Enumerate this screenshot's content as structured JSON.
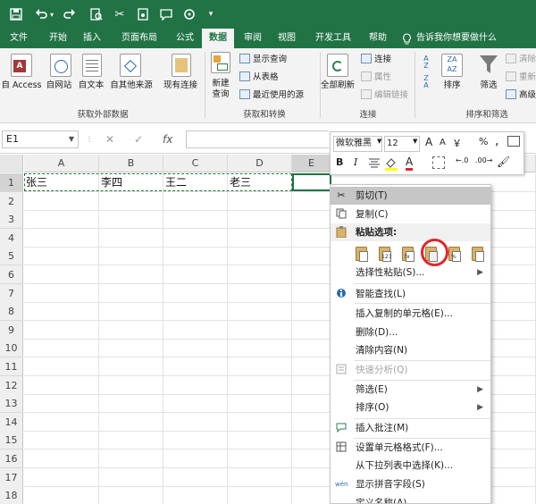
{
  "qat": {
    "icons": [
      "save-icon",
      "undo-icon",
      "undo-dropdown-icon",
      "redo-icon",
      "print-preview-icon",
      "cut-icon",
      "camera-icon",
      "comment-icon",
      "settings-icon",
      "customize-icon"
    ]
  },
  "tabs": [
    "文件",
    "开始",
    "插入",
    "页面布局",
    "公式",
    "数据",
    "审阅",
    "视图",
    "开发工具",
    "帮助",
    "告诉我你想要做什么"
  ],
  "active_tab": "数据",
  "ribbon": {
    "get_external": {
      "label": "获取外部数据",
      "buttons": [
        "自 Access",
        "自网站",
        "自文本",
        "自其他来源",
        "现有连接"
      ]
    },
    "get_transform": {
      "label": "获取和转换",
      "new_query": "新建\n查询",
      "new_query_1": "新建",
      "new_query_2": "查询",
      "small": [
        "显示查询",
        "从表格",
        "最近使用的源"
      ]
    },
    "connections": {
      "label": "连接",
      "refresh_all": "全部刷新",
      "small": [
        "连接",
        "属性",
        "编辑链接"
      ]
    },
    "sort_filter": {
      "label": "排序和筛选",
      "sort": "排序",
      "filter": "筛选",
      "small": [
        "清除",
        "重新",
        "高级"
      ]
    }
  },
  "formula_bar": {
    "name_box": "E1",
    "cancel": "✕",
    "enter": "✓",
    "fx": "fx",
    "value": ""
  },
  "columns": [
    "A",
    "B",
    "C",
    "D",
    "E"
  ],
  "rows": [
    "1",
    "2",
    "3",
    "4",
    "5",
    "6",
    "7",
    "8",
    "9",
    "10",
    "11",
    "12",
    "13",
    "14",
    "15",
    "16",
    "17",
    "18"
  ],
  "cells": {
    "A1": "张三",
    "B1": "李四",
    "C1": "王二",
    "D1": "老三"
  },
  "mini_toolbar": {
    "font_name": "微软雅黑",
    "font_size": "12",
    "grow": "A",
    "shrink": "A",
    "currency": "￥",
    "percent": "%",
    "comma": ",",
    "bold": "B",
    "italic": "I",
    "font_color": "A"
  },
  "context_menu": {
    "items": [
      {
        "label": "剪切(T)",
        "icon": "cut-icon"
      },
      {
        "label": "复制(C)",
        "icon": "copy-icon"
      },
      {
        "label": "粘贴选项:",
        "icon": "paste-icon"
      },
      {
        "label": "选择性粘贴(S)...",
        "icon": ""
      },
      {
        "label": "智能查找(L)",
        "icon": "smart-lookup-icon"
      },
      {
        "label": "插入复制的单元格(E)...",
        "icon": ""
      },
      {
        "label": "删除(D)...",
        "icon": ""
      },
      {
        "label": "清除内容(N)",
        "icon": ""
      },
      {
        "label": "快速分析(Q)",
        "icon": "quick-analysis-icon"
      },
      {
        "label": "筛选(E)",
        "icon": ""
      },
      {
        "label": "排序(O)",
        "icon": ""
      },
      {
        "label": "插入批注(M)",
        "icon": "insert-comment-icon"
      },
      {
        "label": "设置单元格格式(F)...",
        "icon": "format-cells-icon"
      },
      {
        "label": "从下拉列表中选择(K)...",
        "icon": ""
      },
      {
        "label": "显示拼音字段(S)",
        "icon": "phonetic-icon"
      },
      {
        "label": "定义名称(A)...",
        "icon": ""
      }
    ],
    "paste_options": [
      "123",
      "fx",
      "%",
      ""
    ]
  }
}
